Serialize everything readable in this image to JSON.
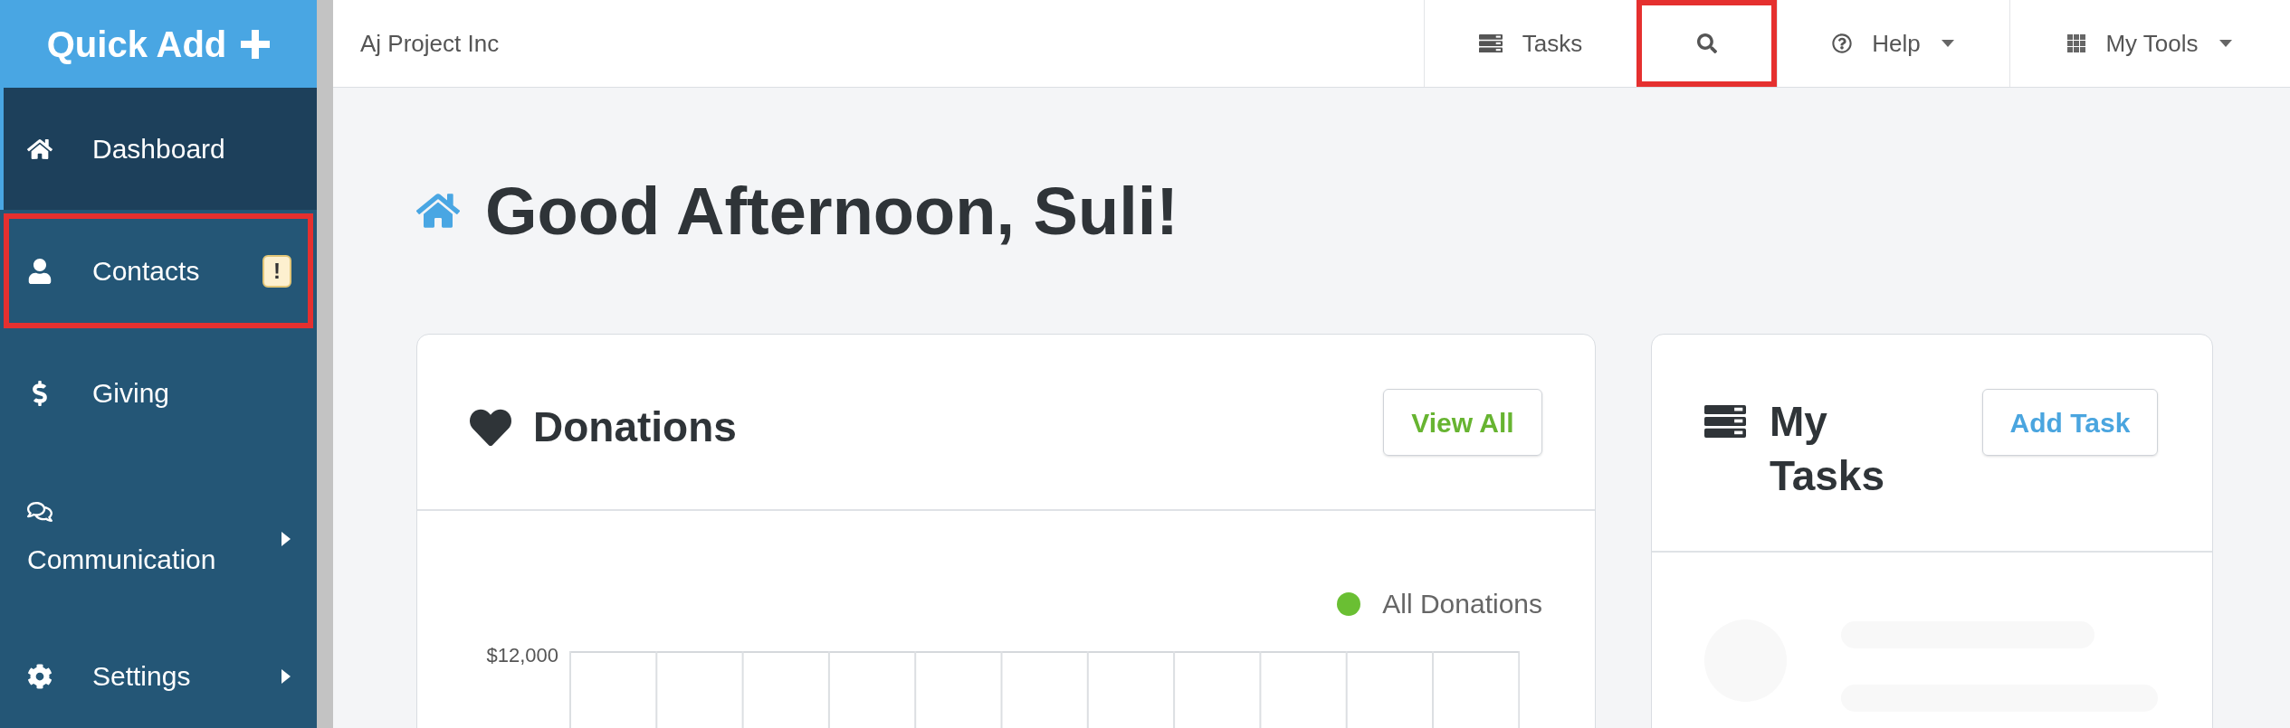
{
  "sidebar": {
    "quick_add": "Quick Add",
    "items": [
      {
        "label": "Dashboard",
        "selected": true,
        "highlighted": false,
        "has_submenu": false
      },
      {
        "label": "Contacts",
        "selected": false,
        "highlighted": true,
        "has_submenu": false,
        "badge": "!"
      },
      {
        "label": "Giving",
        "selected": false,
        "highlighted": false,
        "has_submenu": false
      },
      {
        "label": "Communication",
        "selected": false,
        "highlighted": false,
        "has_submenu": true
      },
      {
        "label": "Settings",
        "selected": false,
        "highlighted": false,
        "has_submenu": true
      }
    ]
  },
  "top_bar": {
    "organization": "Aj Project Inc",
    "nav": [
      {
        "kind": "tasks",
        "label": "Tasks",
        "highlighted": false,
        "has_menu": false
      },
      {
        "kind": "search",
        "highlighted": true,
        "has_menu": false
      },
      {
        "kind": "help",
        "label": "Help",
        "highlighted": false,
        "has_menu": true
      },
      {
        "kind": "tools",
        "label": "My Tools",
        "highlighted": false,
        "has_menu": true
      }
    ]
  },
  "greeting": "Good Afternoon, Suli!",
  "donations": {
    "title": "Donations",
    "button": "View All",
    "legend": [
      {
        "label": "All Donations",
        "color": "#6abf33"
      }
    ],
    "y_tick": "$12,000"
  },
  "tasks": {
    "title": "My Tasks",
    "button": "Add Task"
  }
}
